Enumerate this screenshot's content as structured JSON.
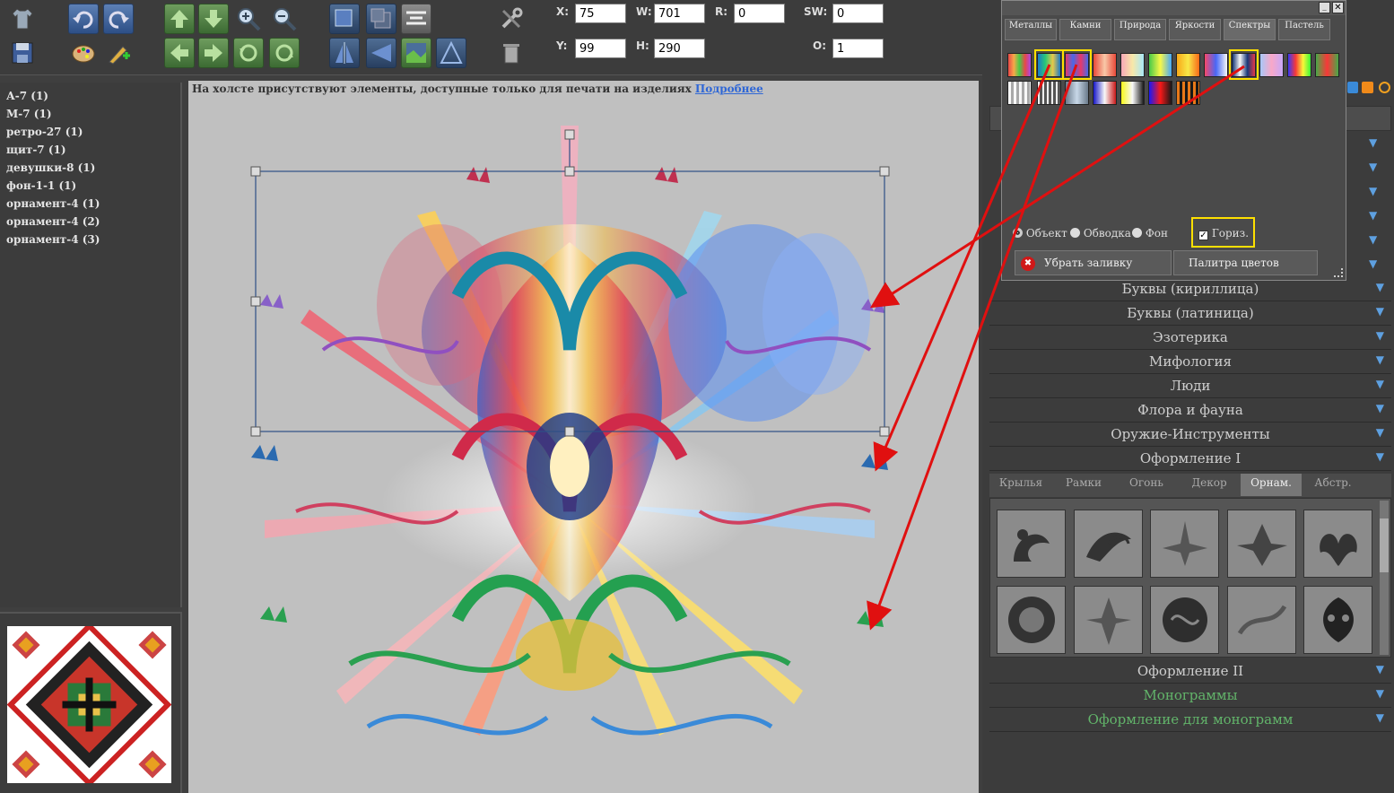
{
  "fields": {
    "x_label": "X:",
    "x_value": "75",
    "w_label": "W:",
    "w_value": "701",
    "r_label": "R:",
    "r_value": "0",
    "sw_label": "SW:",
    "sw_value": "0",
    "y_label": "Y:",
    "y_value": "99",
    "h_label": "H:",
    "h_value": "290",
    "o_label": "O:",
    "o_value": "1"
  },
  "layers": [
    "А-7 (1)",
    "М-7 (1)",
    "ретро-27 (1)",
    "щит-7 (1)",
    "девушки-8 (1)",
    "фон-1-1 (1)",
    "орнамент-4 (1)",
    "орнамент-4 (2)",
    "орнамент-4 (3)"
  ],
  "canvas": {
    "notice": "На холсте присутствуют элементы, доступные только для печати на изделиях",
    "link": "Подробнее"
  },
  "fill_popup": {
    "tabs": [
      "Металлы",
      "Камни",
      "Природа",
      "Яркости",
      "Спектры",
      "Пастель"
    ],
    "active_tab": "Спектры",
    "radio_object": "Объект",
    "radio_stroke": "Обводка",
    "radio_bg": "Фон",
    "horiz_label": "Гориз.",
    "remove_fill": "Убрать заливку",
    "palette": "Палитра цветов"
  },
  "categories": [
    "Буквы (кириллица)",
    "Буквы (латиница)",
    "Эзотерика",
    "Мифология",
    "Люди",
    "Флора и фауна",
    "Оружие-Инструменты",
    "Оформление I"
  ],
  "clipart_tabs": [
    "Крылья",
    "Рамки",
    "Огонь",
    "Декор",
    "Орнам.",
    "Абстр."
  ],
  "active_clipart_tab": "Орнам.",
  "categories_bottom": [
    "Оформление II",
    "Монограммы",
    "Оформление для монограмм"
  ],
  "colors": {
    "accent": "#ffe000",
    "arrow": "#e01010",
    "link": "#2f67d6",
    "green_cat": "#62b46a"
  }
}
